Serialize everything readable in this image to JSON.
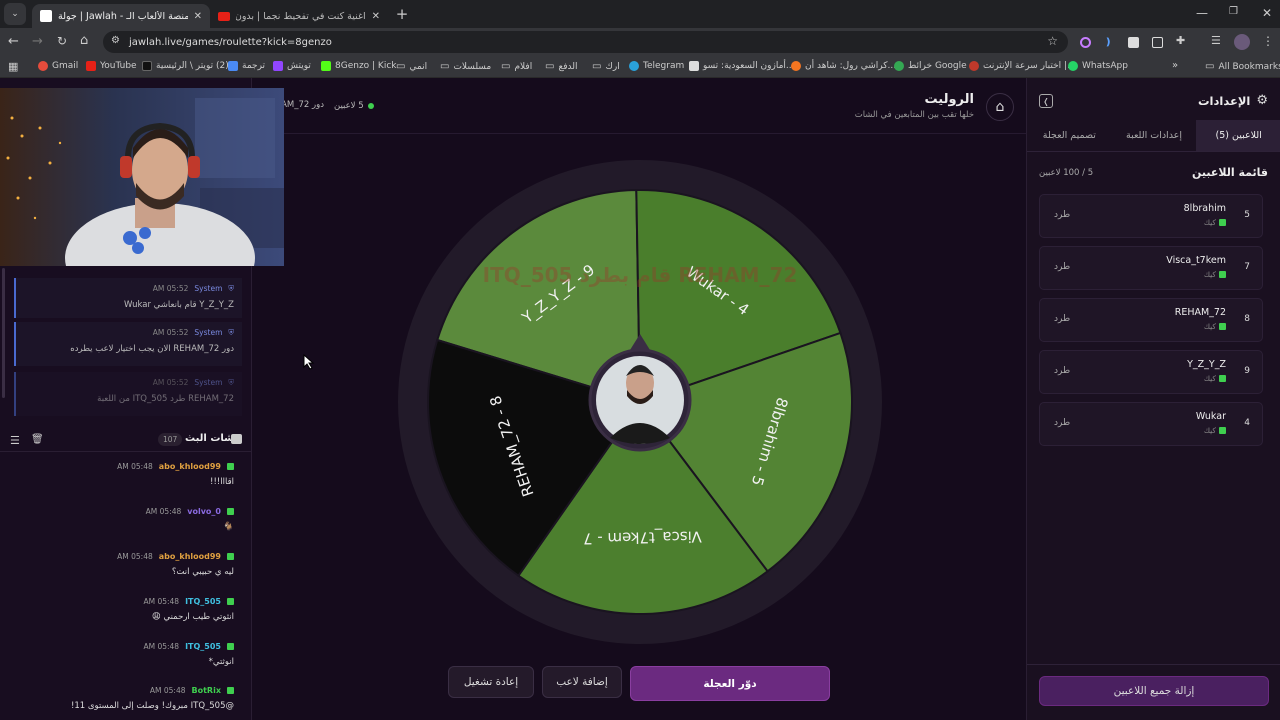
{
  "browser": {
    "tabs": [
      {
        "title": "جولة | Jawlah - منصة الألعاب الـ..."
      },
      {
        "title": "اغنية كنت في تفحيط نجما | بدون"
      }
    ],
    "url": "jawlah.live/games/roulette?kick=8genzo",
    "bookmarks": [
      {
        "label": "Gmail",
        "color": "#e74c3c"
      },
      {
        "label": "YouTube",
        "color": "#e62117"
      },
      {
        "label": "(2) تويتر \\ الرئيسية",
        "color": "#222222"
      },
      {
        "label": "ترجمة",
        "color": "#4a8af4"
      },
      {
        "label": "تويتش",
        "color": "#9146ff"
      },
      {
        "label": "8Genzo | Kick",
        "color": "#53fc18"
      },
      {
        "label": "انمي",
        "color": "#888888"
      },
      {
        "label": "مسلسلات",
        "color": "#888888"
      },
      {
        "label": "افلام",
        "color": "#888888"
      },
      {
        "label": "الدفع",
        "color": "#888888"
      },
      {
        "label": "ارك",
        "color": "#888888"
      },
      {
        "label": "Telegram",
        "color": "#2aa1da"
      },
      {
        "label": "أمازون السعودية: تسو...",
        "color": "#dddddd"
      },
      {
        "label": "كراشي رول: شاهد أن...",
        "color": "#f47521"
      },
      {
        "label": "خرائط Google",
        "color": "#34a853"
      },
      {
        "label": "اختبار سرعة الإنترنت |...",
        "color": "#c0392b"
      },
      {
        "label": "WhatsApp",
        "color": "#25d366"
      }
    ],
    "all_bookmarks": "All Bookmarks"
  },
  "system_log": [
    {
      "sender": "System",
      "time": "05:52 AM",
      "text": "Y_Z_Y_Z قام بانعاشي Wukar"
    },
    {
      "sender": "System",
      "time": "05:52 AM",
      "text": "دور REHAM_72 الان يجب اختيار لاعب يطرده"
    },
    {
      "sender": "System",
      "time": "05:52 AM",
      "text": "REHAM_72 طرد ITQ_505 من اللعبة"
    }
  ],
  "chat": {
    "title": "شات البث",
    "count": "107",
    "messages": [
      {
        "user": "abo_khlood99",
        "user_color": "#e0a040",
        "time": "05:48 AM",
        "text": "اقااا!!!"
      },
      {
        "user": "volvo_0",
        "user_color": "#8a6ae0",
        "time": "05:48 AM",
        "text": "🐐"
      },
      {
        "user": "abo_khlood99",
        "user_color": "#e0a040",
        "time": "05:48 AM",
        "text": "ليه ي حبيبي انت؟"
      },
      {
        "user": "ITQ_505",
        "user_color": "#3fbfe0",
        "time": "05:48 AM",
        "text": "انثوتي طيب ارحمني 😩"
      },
      {
        "user": "ITQ_505",
        "user_color": "#3fbfe0",
        "time": "05:48 AM",
        "text": "انوثتي*"
      },
      {
        "user": "BotRix",
        "user_color": "#3fcf4f",
        "time": "05:48 AM",
        "text": "@ITQ_505 مبروك! وصلت إلى المستوى 11!"
      }
    ]
  },
  "game": {
    "title": "الروليت",
    "subtitle": "خلها تقب بين المتابعين في الشات",
    "players_count": "5 لاعبين",
    "turn": "دور REHAM_72",
    "banner": "REHAM_72 قام بطرد ITQ_505",
    "segments": [
      {
        "label": "Y_Z_Y_Z - 9",
        "color": "#5b8a3c"
      },
      {
        "label": "Wukar - 4",
        "color": "#4a7e2c"
      },
      {
        "label": "8lbrahim - 5",
        "color": "#538434"
      },
      {
        "label": "Visca_t7kem - 7",
        "color": "#4c7f2e"
      },
      {
        "label": "REHAM_72 - 8",
        "color": "#0c0c0c"
      }
    ],
    "buttons": {
      "spin": "دوّر العجلة",
      "add_player": "إضافة لاعب",
      "restart": "إعادة تشغيل"
    }
  },
  "settings": {
    "title": "الإعدادات",
    "tabs": [
      "اللاعبين (5)",
      "إعدادات اللعبة",
      "تصميم العجلة"
    ],
    "list_title": "قائمة اللاعبين",
    "list_count": "5 / 100 لاعبين",
    "kick_label": "طرد",
    "platform": "كيك",
    "players": [
      {
        "num": "5",
        "name": "8lbrahim"
      },
      {
        "num": "7",
        "name": "Visca_t7kem"
      },
      {
        "num": "8",
        "name": "REHAM_72"
      },
      {
        "num": "9",
        "name": "Y_Z_Y_Z"
      },
      {
        "num": "4",
        "name": "Wukar"
      }
    ],
    "remove_all": "إزالة جميع اللاعبين"
  }
}
